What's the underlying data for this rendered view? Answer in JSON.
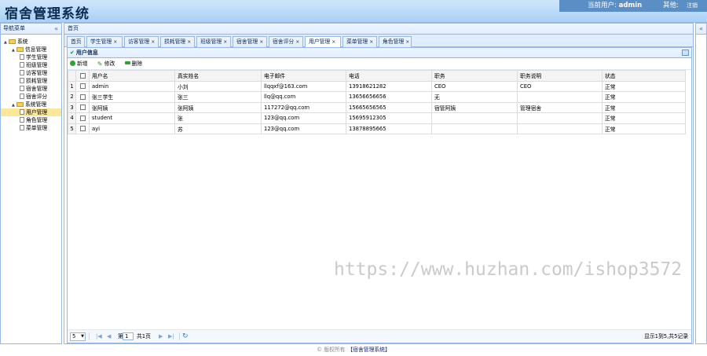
{
  "header": {
    "title": "宿舍管理系统",
    "current_user_label": "当前用户:",
    "username": "admin",
    "other_label": "其他:",
    "logout_label": "注销"
  },
  "nav": {
    "title": "导航菜单",
    "collapse_icon": "double-left-chevron-icon",
    "tree": [
      {
        "label": "系统",
        "level": 0,
        "type": "folder"
      },
      {
        "label": "信息管理",
        "level": 1,
        "type": "folder"
      },
      {
        "label": "学生管理",
        "level": 2,
        "type": "file"
      },
      {
        "label": "班级管理",
        "level": 2,
        "type": "file"
      },
      {
        "label": "访客管理",
        "level": 2,
        "type": "file"
      },
      {
        "label": "损耗管理",
        "level": 2,
        "type": "file"
      },
      {
        "label": "宿舍管理",
        "level": 2,
        "type": "file"
      },
      {
        "label": "宿舍评分",
        "level": 2,
        "type": "file"
      },
      {
        "label": "系统管理",
        "level": 1,
        "type": "folder"
      },
      {
        "label": "用户管理",
        "level": 2,
        "type": "file",
        "selected": true
      },
      {
        "label": "角色管理",
        "level": 2,
        "type": "file"
      },
      {
        "label": "菜单管理",
        "level": 2,
        "type": "file"
      }
    ]
  },
  "main": {
    "title": "首页",
    "tabs": [
      {
        "label": "首页",
        "closable": false
      },
      {
        "label": "学生管理",
        "closable": true
      },
      {
        "label": "访客管理",
        "closable": true
      },
      {
        "label": "损耗管理",
        "closable": true
      },
      {
        "label": "班级管理",
        "closable": true
      },
      {
        "label": "宿舍管理",
        "closable": true
      },
      {
        "label": "宿舍评分",
        "closable": true
      },
      {
        "label": "用户管理",
        "closable": true,
        "active": true
      },
      {
        "label": "菜单管理",
        "closable": true
      },
      {
        "label": "角色管理",
        "closable": true
      }
    ]
  },
  "grid": {
    "title": "用户信息",
    "toolbar": {
      "add": "新增",
      "edit": "修改",
      "delete": "删除"
    },
    "columns": [
      "用户名",
      "真实姓名",
      "电子邮件",
      "电话",
      "职务",
      "职务说明",
      "状态"
    ],
    "rows": [
      {
        "n": "1",
        "cells": [
          "admin",
          "小刘",
          "llqqxf@163.com",
          "13918621282",
          "CEO",
          "CEO",
          "正常"
        ]
      },
      {
        "n": "2",
        "cells": [
          "张三学生",
          "张三",
          "llq@qq.com",
          "13656656656",
          "无",
          "",
          "正常"
        ]
      },
      {
        "n": "3",
        "cells": [
          "张阿姨",
          "张阿姨",
          "117272@qq.com",
          "15665656565",
          "宿管阿姨",
          "管理宿舍",
          "正常"
        ]
      },
      {
        "n": "4",
        "cells": [
          "student",
          "张",
          "123@qq.com",
          "15695912305",
          "",
          "",
          "正常"
        ]
      },
      {
        "n": "5",
        "cells": [
          "ayi",
          "苏",
          "123@qq.com",
          "13878895665",
          "",
          "",
          "正常"
        ]
      }
    ]
  },
  "pager": {
    "page_size": "5",
    "page_prefix": "第",
    "page_value": "1",
    "page_total": "共1页",
    "summary": "显示1到5,共5记录"
  },
  "watermark": "https://www.huzhan.com/ishop3572",
  "footer": {
    "copyright": "© 版权所有",
    "system_link": "【宿舍管理系统】"
  }
}
